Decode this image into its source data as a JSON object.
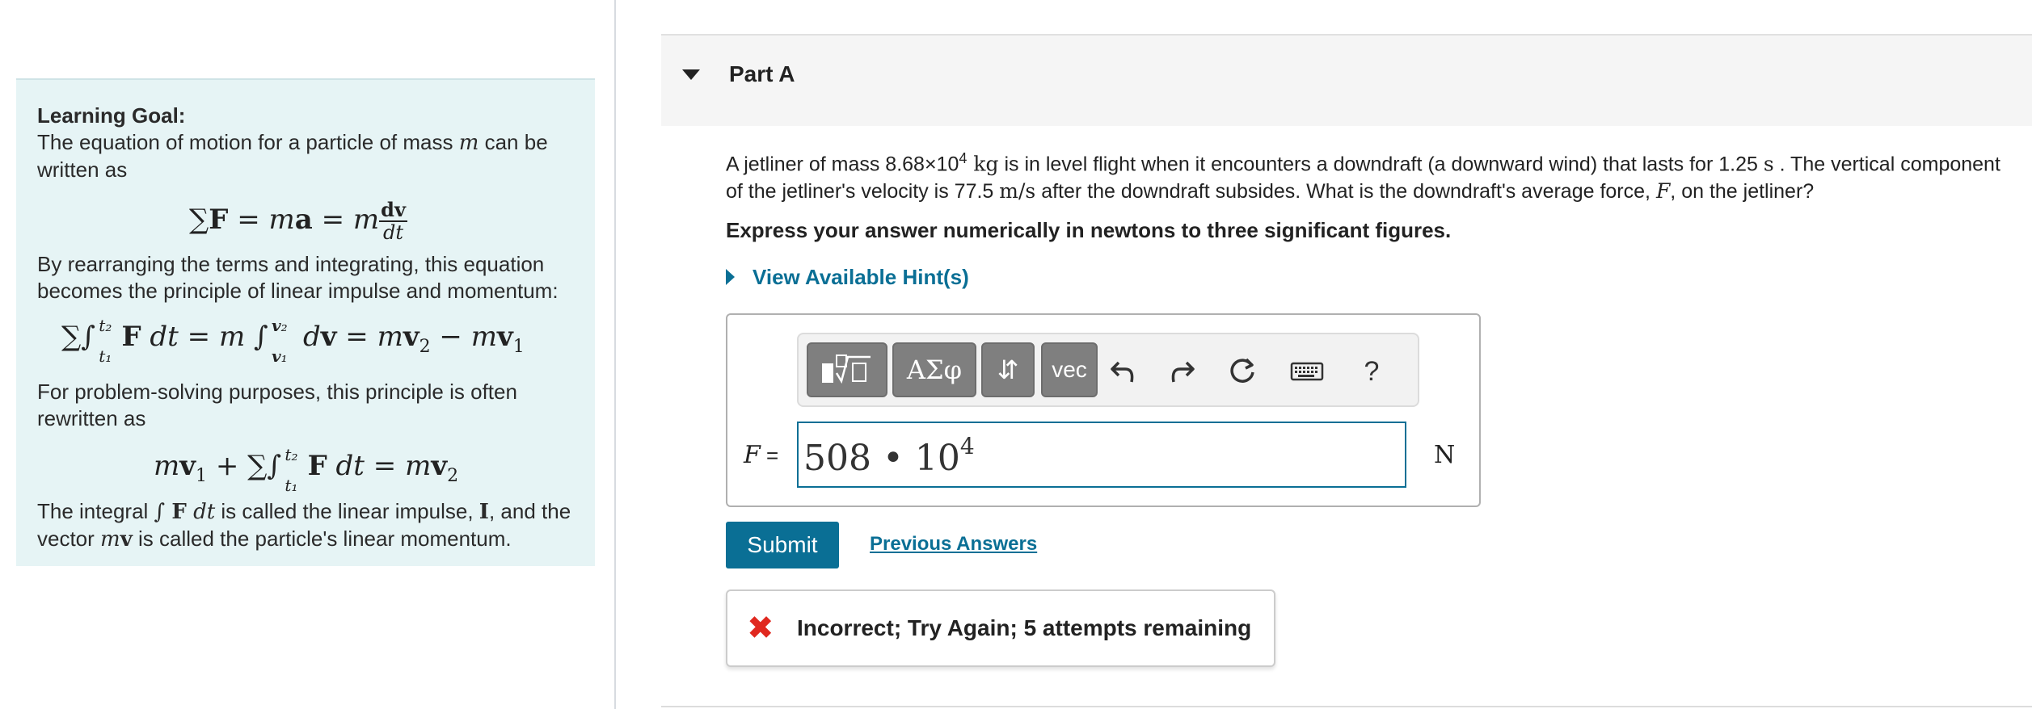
{
  "learning_goal": {
    "title": "Learning Goal:",
    "p1_a": "The equation of motion for a particle of mass ",
    "p1_var": "m",
    "p1_b": " can be written as",
    "p2": "By rearranging the terms and integrating, this equation becomes the principle of linear impulse and momentum:",
    "p3": "For problem-solving purposes, this principle is often rewritten as",
    "p4_a": "The integral ",
    "p4_b": " is called the linear impulse, ",
    "p4_I": "I",
    "p4_c": ", and the vector ",
    "p4_d": " is called the particle's linear momentum."
  },
  "part": {
    "title": "Part A"
  },
  "question": {
    "t1": "A jetliner of mass 8.68×10",
    "t1_exp": "4",
    "t1_unit": " kg",
    "t2": " is in level flight when it encounters a downdraft (a downward wind) that lasts for 1.25 ",
    "t2_unit": "s",
    "t3": " . The vertical component of the jetliner's velocity is 77.5 ",
    "t3_unit": "m/s",
    "t4": " after the downdraft subsides.  What is the downdraft's average force, ",
    "t4_var": "F",
    "t5": ", on the jetliner?"
  },
  "instruction": "Express your answer numerically in newtons to three significant figures.",
  "hints_label": "View Available Hint(s)",
  "toolbar": {
    "greek_label": "ΑΣφ",
    "arrows_label": "⇵",
    "vec_label": "vec",
    "help_label": "?"
  },
  "answer": {
    "var_label": "F",
    "equals": " =",
    "value_mantissa": "508 • 10",
    "value_exp": "4",
    "unit": "N"
  },
  "submit_label": "Submit",
  "previous_answers_label": "Previous Answers",
  "feedback": {
    "message": "Incorrect; Try Again; 5 attempts remaining",
    "status_color": "#e0281f"
  },
  "colors": {
    "accent": "#0a6f95",
    "goal_bg": "#e6f4f5"
  }
}
